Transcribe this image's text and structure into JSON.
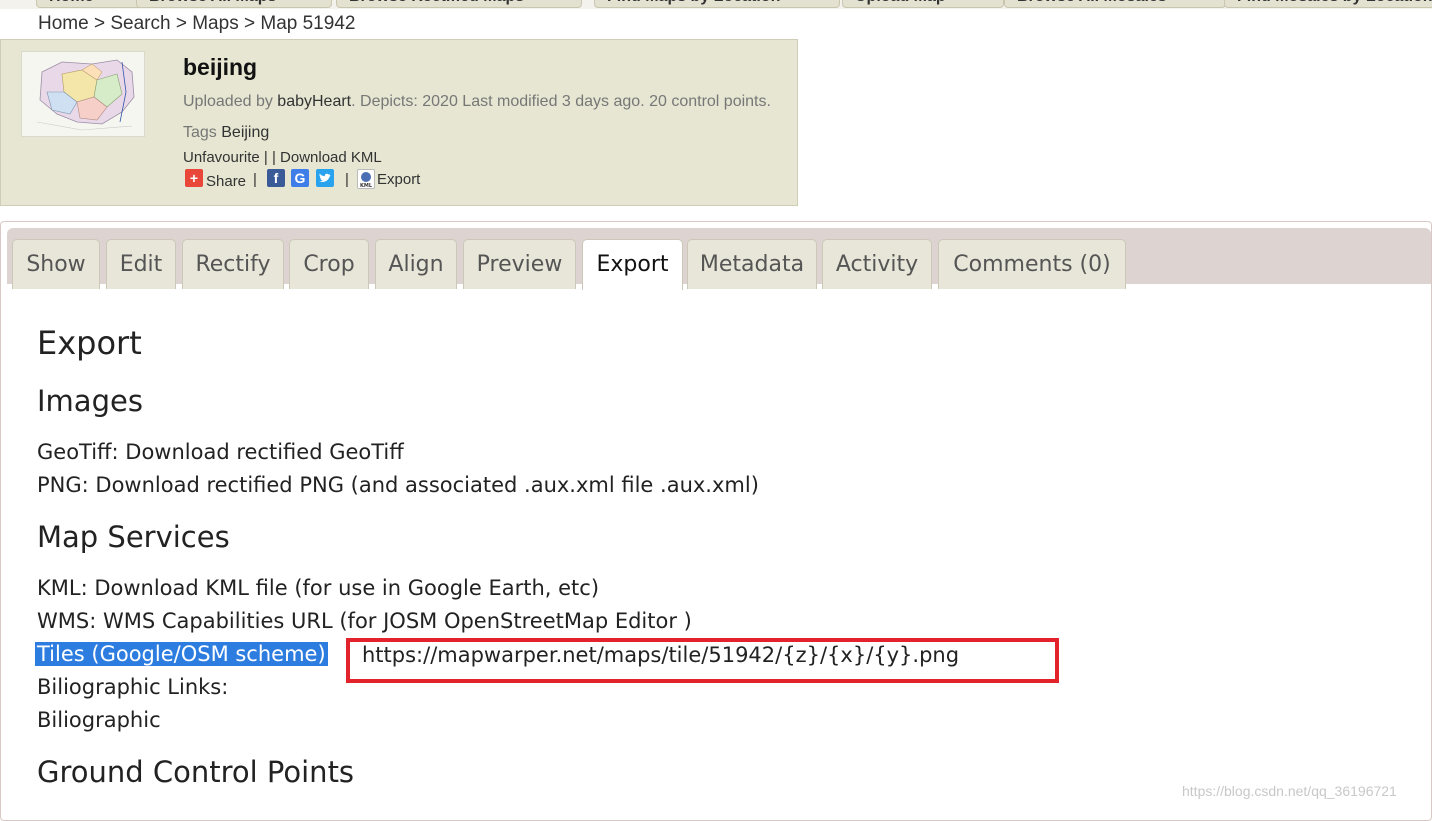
{
  "top_nav": [
    "Home",
    "Browse All Maps",
    "Browse Rectified Maps",
    "Find Maps by Location",
    "Upload Map",
    "Browse All Mosaics",
    "Find Mosaics by Location"
  ],
  "breadcrumb": {
    "home": "Home",
    "search": "Search",
    "maps": "Maps",
    "current": "Map 51942",
    "sep": ">"
  },
  "map": {
    "title": "beijing",
    "uploaded_prefix": "Uploaded by",
    "uploader": "babyHeart",
    "details": ". Depicts: 2020 Last modified 3 days ago. 20 control points.",
    "tags_label": "Tags",
    "tag": "Beijing",
    "unfavourite": "Unfavourite",
    "sep1": "| |",
    "download_kml": "Download KML",
    "share": "Share",
    "bar": "|",
    "export": "Export"
  },
  "tabs": [
    "Show",
    "Edit",
    "Rectify",
    "Crop",
    "Align",
    "Preview",
    "Export",
    "Metadata",
    "Activity",
    "Comments (0)"
  ],
  "active_tab": "Export",
  "content": {
    "heading": "Export",
    "images_heading": "Images",
    "geotiff": "GeoTiff: Download rectified GeoTiff",
    "png": "PNG: Download rectified PNG (and associated .aux.xml file .aux.xml)",
    "services_heading": "Map Services",
    "kml": "KML: Download KML file (for use in Google Earth, etc)",
    "wms": "WMS: WMS Capabilities URL (for JOSM OpenStreetMap Editor )",
    "tiles_label": "Tiles (Google/OSM scheme)",
    "tiles_url": "https://mapwarper.net/maps/tile/51942/{z}/{x}/{y}.png",
    "biblio_links": "Biliographic Links:",
    "biblio": "Biliographic",
    "gcp_heading": "Ground Control Points"
  },
  "watermark": "https://blog.csdn.net/qq_36196721",
  "colors": {
    "mapbox_bg": "#e6e6d2",
    "tabbar_bg": "#ddd4d2",
    "selection": "#2d7de0",
    "highlight_box": "#e2232b"
  }
}
